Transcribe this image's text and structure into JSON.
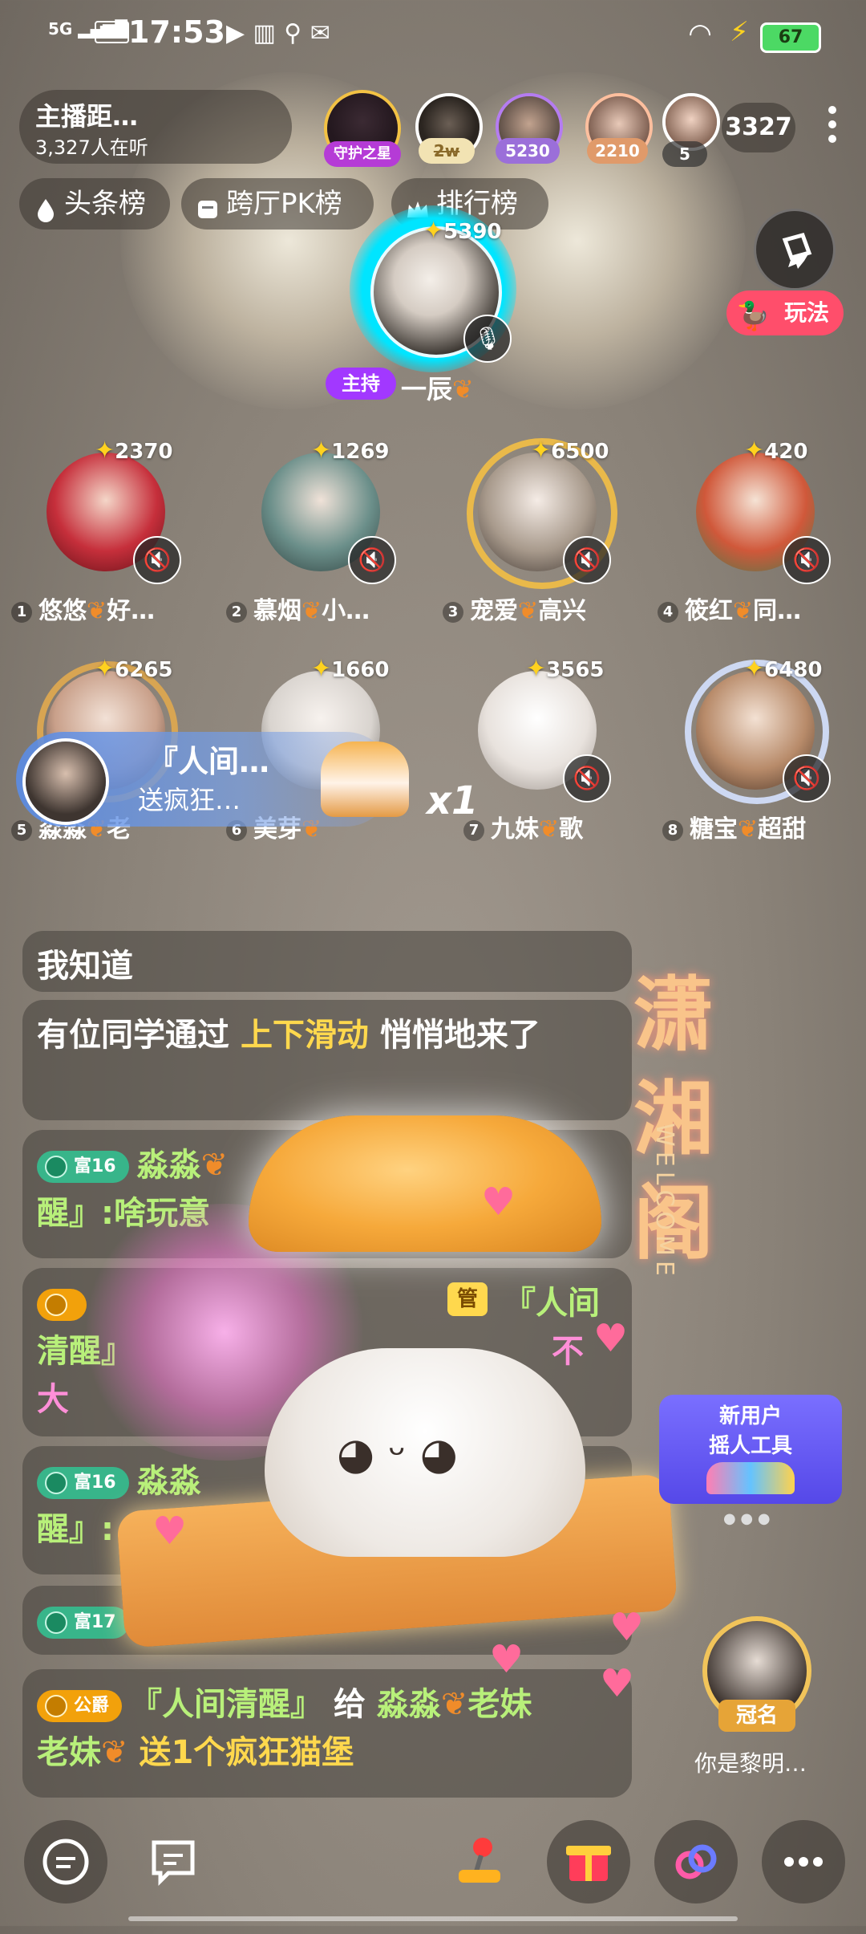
{
  "status_bar": {
    "network": "5G",
    "hd": "HD",
    "time": "17:53",
    "battery": "67"
  },
  "header": {
    "room_title": "主播距…",
    "listeners": "3,327人在听",
    "guardian_badge": "守护之星",
    "top_fans": [
      {
        "badge": "2w"
      },
      {
        "badge": "5230"
      },
      {
        "badge": "2210"
      },
      {
        "badge": "5"
      }
    ],
    "online_count": "3327"
  },
  "rank_tabs": [
    {
      "label": "头条榜"
    },
    {
      "label": "跨厅PK榜"
    },
    {
      "label": "排行榜"
    }
  ],
  "host": {
    "score": "5390",
    "tag": "主持",
    "name": "一辰"
  },
  "play_button": {
    "label": "玩法"
  },
  "seats": [
    {
      "num": "1",
      "name": "悠悠",
      "suffix": "好…",
      "score": "2370",
      "color": "#c62f3b"
    },
    {
      "num": "2",
      "name": "慕烟",
      "suffix": "小…",
      "score": "1269",
      "color": "#6b8f8a"
    },
    {
      "num": "3",
      "name": "宠爱",
      "suffix": "高兴",
      "score": "6500",
      "color": "#a89a8c"
    },
    {
      "num": "4",
      "name": "筱红",
      "suffix": "同…",
      "score": "420",
      "color": "#d0583a"
    },
    {
      "num": "5",
      "name": "淼淼",
      "suffix": "老",
      "score": "6265",
      "color": "#c9a08a"
    },
    {
      "num": "6",
      "name": "美芽",
      "suffix": "",
      "score": "1660",
      "color": "#d9d4cf"
    },
    {
      "num": "7",
      "name": "九妹",
      "suffix": "歌",
      "score": "3565",
      "color": "#e8e2dd"
    },
    {
      "num": "8",
      "name": "糖宝",
      "suffix": "超甜",
      "score": "6480",
      "color": "#b88b6a"
    }
  ],
  "gift_banner": {
    "name": "『人间…",
    "sub": "送疯狂…",
    "multiplier": "x1"
  },
  "chat": {
    "header": "我知道",
    "system_msg": {
      "pre": "有位同学通过 ",
      "highlight": "上下滑动",
      "post": " 悄悄地来了"
    },
    "messages": [
      {
        "level": "富16",
        "user": "淼淼",
        "text": "醒』:啥玩意"
      },
      {
        "level": "",
        "user": "",
        "tag": "管",
        "text1": "『人间",
        "text2": "清醒』",
        "text3": "不",
        "text4": "大"
      },
      {
        "level": "富16",
        "user": "淼淼",
        "text": "醒』:"
      },
      {
        "level": "富17",
        "user": "",
        "text": ""
      }
    ],
    "gift_msg": {
      "level": "公爵",
      "user": "『人间清醒』",
      "action": " 给 ",
      "target": "淼淼",
      "target2": "老妹",
      "gift": " 送1个疯狂猫堡"
    }
  },
  "promo": {
    "title": "潇湘阁",
    "welcome": "WELCOME",
    "new_user_line1": "新用户",
    "new_user_line2": "摇人工具"
  },
  "crown_user": {
    "tag": "冠名",
    "name": "你是黎明…"
  },
  "bottom_bar": [
    {
      "icon": "chat-bubble-icon"
    },
    {
      "icon": "message-icon"
    },
    {
      "icon": "joystick-icon"
    },
    {
      "icon": "gift-icon"
    },
    {
      "icon": "link-icon"
    },
    {
      "icon": "more-icon"
    }
  ]
}
